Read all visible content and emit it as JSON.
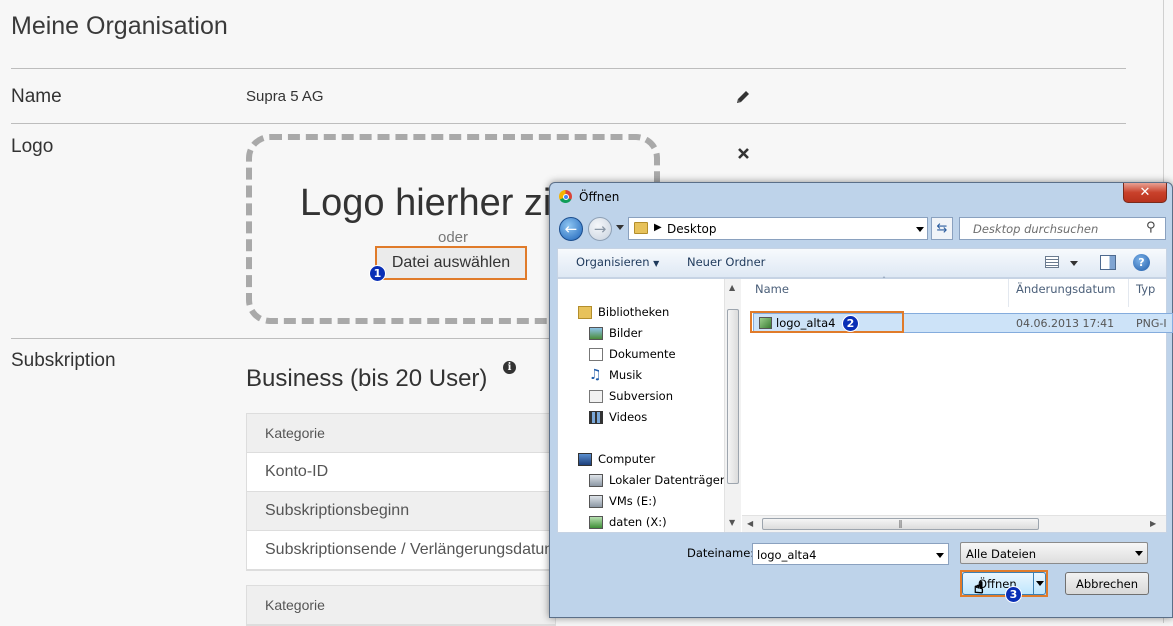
{
  "page": {
    "title": "Meine Organisation",
    "name_label": "Name",
    "org_name": "Supra 5 AG",
    "logo_label": "Logo",
    "dropzone_text": "Logo hierher ziehen",
    "dropzone_or": "oder",
    "file_button": "Datei auswählen",
    "subscription_label": "Subskription",
    "plan": "Business (bis 20 User)",
    "table1": [
      "Kategorie",
      "Konto-ID",
      "Subskriptionsbeginn",
      "Subskriptionsende / Verlängerungsdatum"
    ],
    "table2": [
      "Kategorie"
    ]
  },
  "badges": [
    "1",
    "2",
    "3"
  ],
  "dialog": {
    "title": "Öffnen",
    "close_label": "✕",
    "path": "Desktop",
    "search_placeholder": "Desktop durchsuchen",
    "toolbar": {
      "organize": "Organisieren",
      "new_folder": "Neuer Ordner"
    },
    "nav": {
      "libraries": "Bibliotheken",
      "library_items": [
        "Bilder",
        "Dokumente",
        "Musik",
        "Subversion",
        "Videos"
      ],
      "computer": "Computer",
      "drives": [
        "Lokaler Datenträger (",
        "VMs (E:)",
        "daten (X:)"
      ]
    },
    "columns": {
      "name": "Name",
      "date": "Änderungsdatum",
      "type": "Typ"
    },
    "files": [
      {
        "name": "logo_alta4",
        "date": "04.06.2013 17:41",
        "type": "PNG-I"
      }
    ],
    "filename_label": "Dateiname:",
    "filename_value": "logo_alta4",
    "filetype": "Alle Dateien",
    "open_button": "Öffnen",
    "cancel_button": "Abbrechen"
  }
}
